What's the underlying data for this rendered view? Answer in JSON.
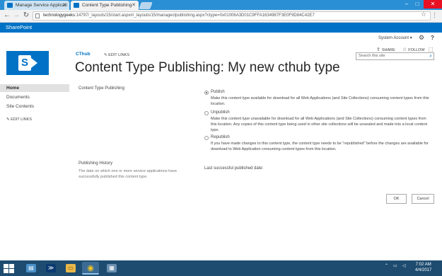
{
  "browser": {
    "tabs": [
      {
        "label": "Manage Service Applicati",
        "active": false
      },
      {
        "label": "Content Type Publishing",
        "active": true
      }
    ],
    "url_host": "technologygeeks",
    "url_rest": ":14797/_layouts/15/start.aspx#/_layouts/15/managectpublishing.aspx?ctype=0x01006A3D01C9FFA1634987F3E0F9D84C42E7"
  },
  "suite": {
    "brand": "SharePoint",
    "account": "System Account ▾",
    "share": "SHARE",
    "follow": "FOLLOW"
  },
  "header": {
    "site_link": "CThub",
    "edit_links": "EDIT LINKS",
    "title": "Content Type Publishing: My new cthub type",
    "search_placeholder": "Search this site"
  },
  "leftnav": {
    "items": [
      "Home",
      "Documents",
      "Site Contents"
    ],
    "edit_links": "EDIT LINKS"
  },
  "form": {
    "ctp_label": "Content Type Publishing",
    "options": [
      {
        "label": "Publish",
        "checked": true,
        "desc": "Make this content type available for download for all Web Applications (and Site Collections) consuming content types from this location."
      },
      {
        "label": "Unpublish",
        "checked": false,
        "desc": "Make this content type unavailable for download for all Web Applications (and Site Collections) consuming content types from this location. Any copies of this content type being used in other site collections will be unsealed and made into a local content type."
      },
      {
        "label": "Republish",
        "checked": false,
        "desc": "If you have made changes to this content type, the content type needs to be \"republished\" before the changes are available for download to Web Application consuming content types from this location."
      }
    ],
    "history_label": "Publishing History",
    "history_desc": "The date on which one or more service applications have successfully published this content type.",
    "last_published": "Last successful published date:",
    "ok": "OK",
    "cancel": "Cancel"
  },
  "taskbar": {
    "time": "7:02 AM",
    "date": "4/4/2017"
  },
  "colors": {
    "brand_blue": "#0072c6",
    "suite_bar": "#0072c6",
    "tab_strip": "#2a8fd4",
    "taskbar": "#1e4c70"
  }
}
